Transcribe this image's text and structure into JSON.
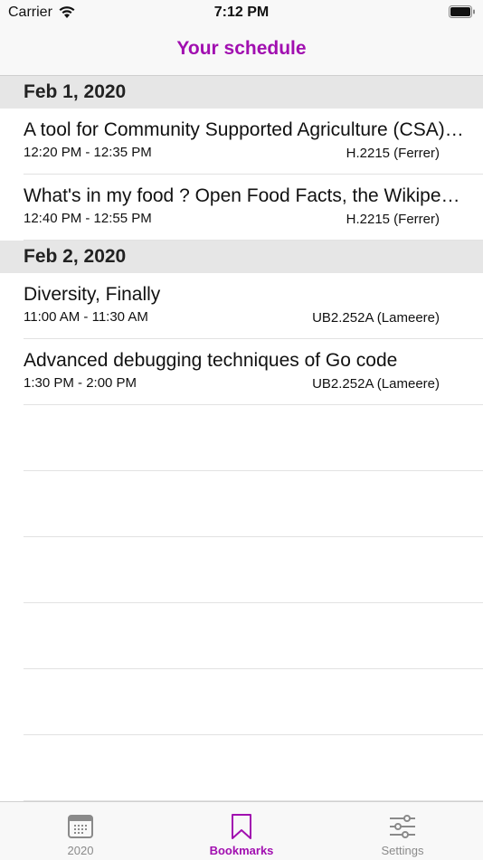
{
  "status": {
    "carrier": "Carrier",
    "time": "7:12 PM"
  },
  "nav": {
    "title": "Your schedule"
  },
  "sections": [
    {
      "date": "Feb 1, 2020",
      "items": [
        {
          "title": "A tool for Community Supported Agriculture (CSA) management, OpenOlitor",
          "time": "12:20 PM - 12:35 PM",
          "room": "H.2215 (Ferrer)"
        },
        {
          "title": "What's in my food ? Open Food Facts, the Wikipedia of Food",
          "time": "12:40 PM - 12:55 PM",
          "room": "H.2215 (Ferrer)"
        }
      ]
    },
    {
      "date": "Feb 2, 2020",
      "items": [
        {
          "title": "Diversity, Finally",
          "time": "11:00 AM - 11:30 AM",
          "room": "UB2.252A (Lameere)"
        },
        {
          "title": "Advanced debugging techniques of Go code",
          "time": "1:30 PM - 2:00 PM",
          "room": "UB2.252A (Lameere)"
        }
      ]
    }
  ],
  "tabs": [
    {
      "label": "2020",
      "icon": "calendar-icon"
    },
    {
      "label": "Bookmarks",
      "icon": "bookmark-icon",
      "active": true
    },
    {
      "label": "Settings",
      "icon": "sliders-icon"
    }
  ],
  "colors": {
    "accent": "#a10fb0"
  }
}
